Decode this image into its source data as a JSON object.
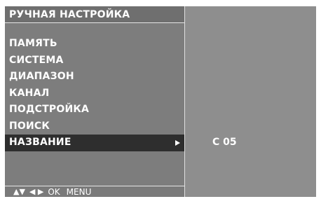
{
  "menu": {
    "title": "РУЧНАЯ НАСТРОЙКА",
    "items": [
      {
        "label": "ПАМЯТЬ"
      },
      {
        "label": "СИСТЕМА"
      },
      {
        "label": "ДИАПАЗОН"
      },
      {
        "label": "КАНАЛ"
      },
      {
        "label": "ПОДСТРОЙКА"
      },
      {
        "label": "ПОИСК"
      },
      {
        "label": "НАЗВАНИЕ",
        "selected": true
      }
    ]
  },
  "value_panel": {
    "value": "C 05"
  },
  "nav_hint": {
    "up_down_glyph": "▲▼",
    "left_right_glyph": "◀ ▶",
    "ok_label": "OK",
    "menu_label": "MENU"
  }
}
